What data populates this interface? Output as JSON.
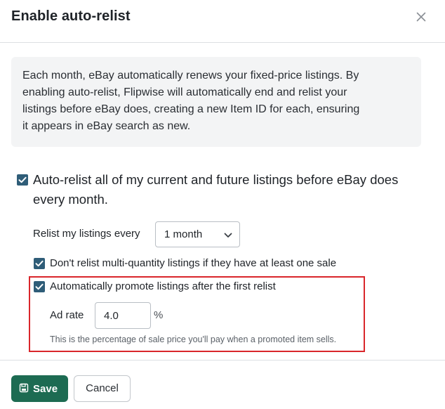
{
  "dialog": {
    "title": "Enable auto-relist",
    "close_icon": "close-icon"
  },
  "info": {
    "line1": "Each month, eBay automatically renews your fixed-price listings. By",
    "line2": "enabling auto-relist, Flipwise will automatically end and relist your",
    "line3": "listings before eBay does, creating a new Item ID for each, ensuring",
    "line4": "it appears in eBay search as new."
  },
  "auto_relist": {
    "checked": true,
    "label": "Auto-relist all of my current and future listings before eBay does every month."
  },
  "relist_every": {
    "label": "Relist my listings every",
    "selected": "1 month",
    "icon": "chevron-down-icon"
  },
  "options": {
    "skip_multi_qty": {
      "checked": true,
      "label": "Don't relist multi-quantity listings if they have at least one sale"
    },
    "auto_promote": {
      "checked": true,
      "label": "Automatically promote listings after the first relist"
    }
  },
  "ad_rate": {
    "label": "Ad rate",
    "value": "4.0",
    "unit": "%",
    "help": "This is the percentage of sale price you'll pay when a promoted item sells."
  },
  "footer": {
    "save_label": "Save",
    "save_icon": "save-icon",
    "cancel_label": "Cancel"
  },
  "colors": {
    "primary": "#1d6b52",
    "checkbox": "#2f5d78",
    "highlight": "#d9262b",
    "info_bg": "#f3f4f5"
  }
}
